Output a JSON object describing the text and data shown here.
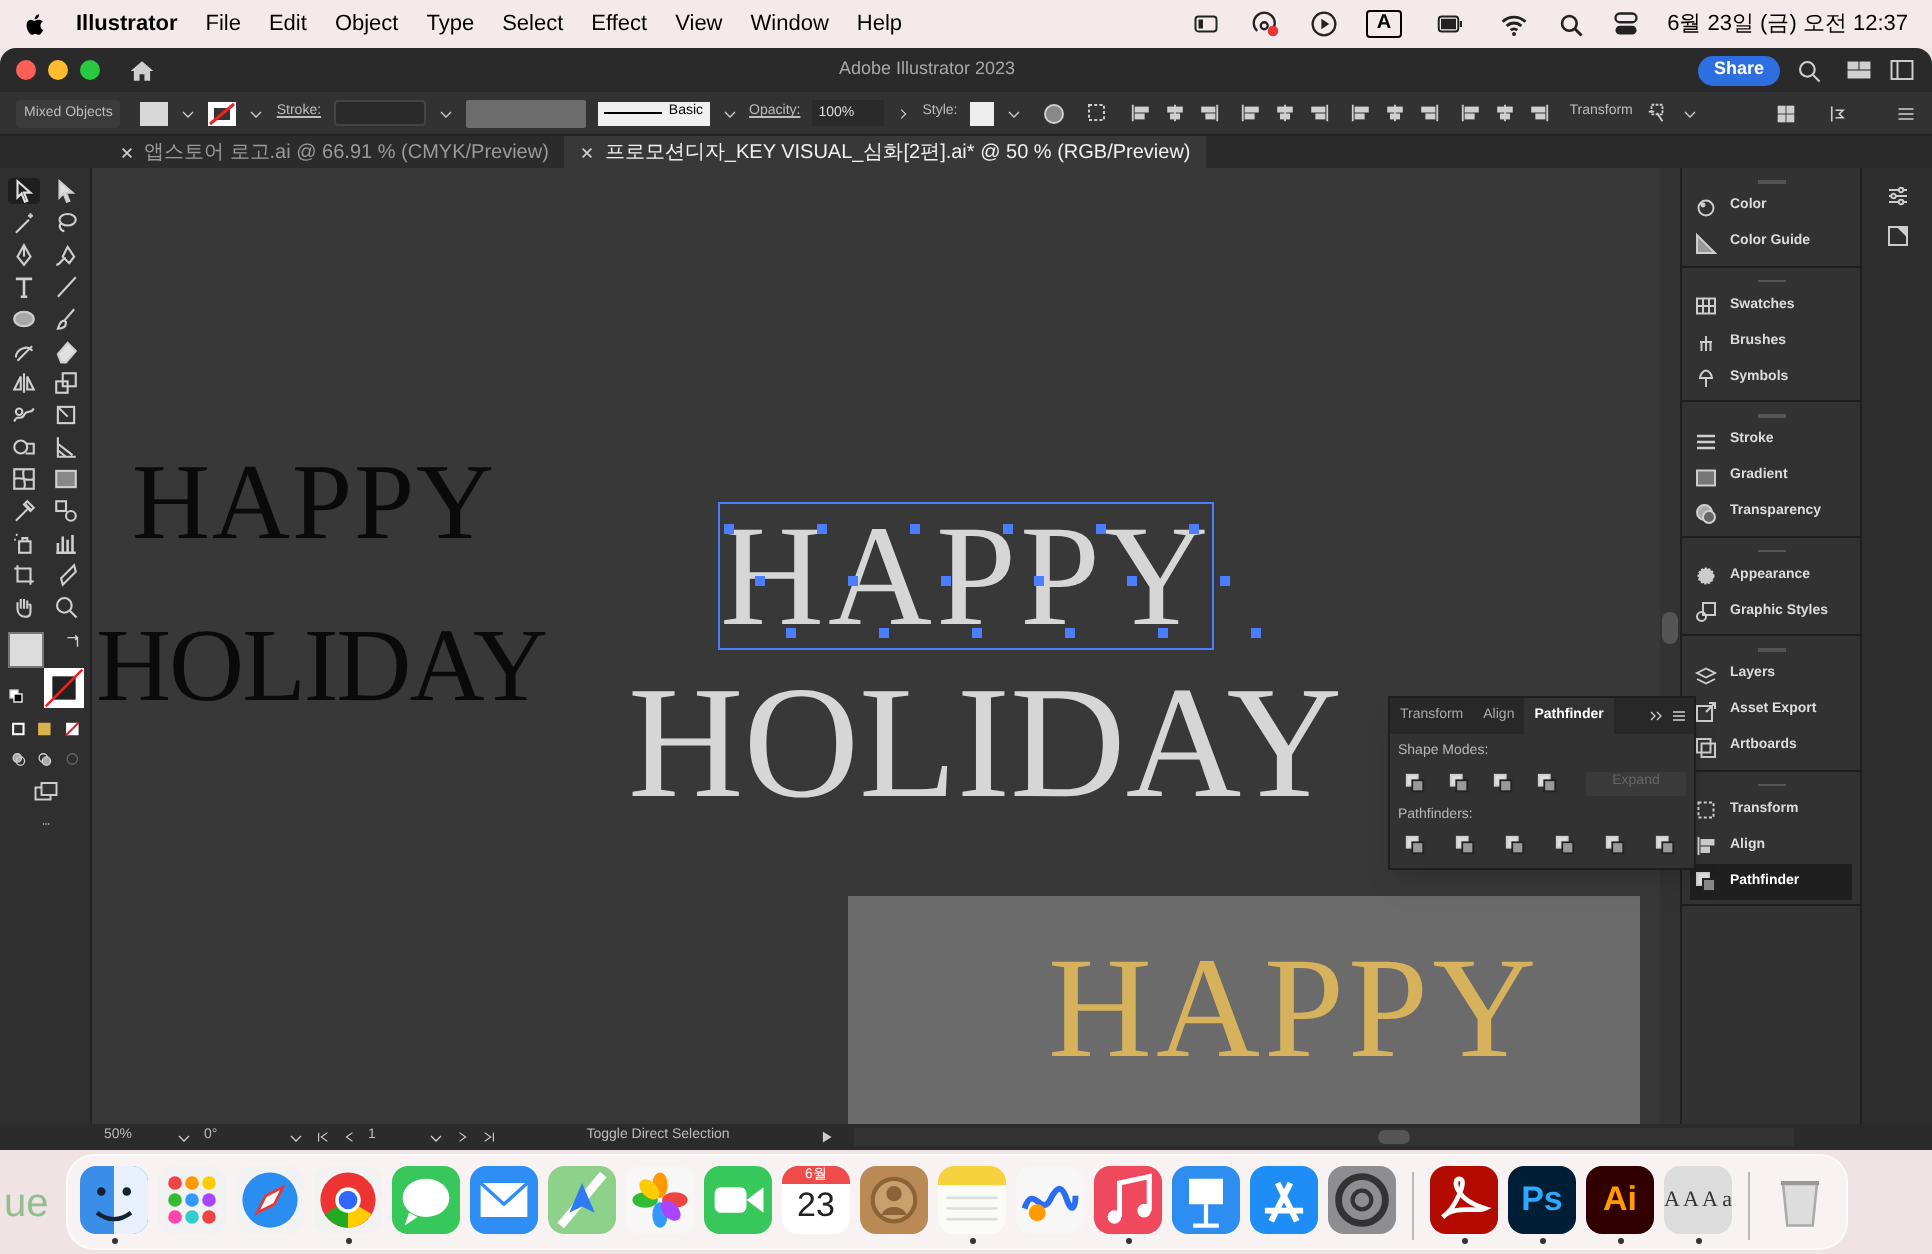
{
  "menu_bar": {
    "app": "Illustrator",
    "menus": [
      "File",
      "Edit",
      "Object",
      "Type",
      "Select",
      "Effect",
      "View",
      "Window",
      "Help"
    ],
    "input_source": "A",
    "clock": "6월 23일 (금) 오전 12:37"
  },
  "window": {
    "title": "Adobe Illustrator 2023",
    "share": "Share"
  },
  "control_bar": {
    "selection": "Mixed Objects",
    "stroke_label": "Stroke:",
    "brush": "Basic",
    "opacity_label": "Opacity:",
    "opacity": "100%",
    "style_label": "Style:",
    "transform": "Transform"
  },
  "doc_tabs": [
    {
      "label": "앱스토어 로고.ai @ 66.91 % (CMYK/Preview)",
      "selected": false
    },
    {
      "label": "프로모션디자_KEY VISUAL_심화[2편].ai* @ 50 % (RGB/Preview)",
      "selected": true
    }
  ],
  "artwork": [
    {
      "kind": "black",
      "text": "HAPPY",
      "selected": false
    },
    {
      "kind": "black",
      "text": "HOLIDAY",
      "selected": false
    },
    {
      "kind": "white",
      "text": "HAPPY",
      "selected": true
    },
    {
      "kind": "white",
      "text": "HOLIDAY",
      "selected": false
    },
    {
      "kind": "gold",
      "text": "HAPPY",
      "selected": false
    }
  ],
  "panels": [
    [
      {
        "label": "Color",
        "selected": false
      },
      {
        "label": "Color Guide",
        "selected": false
      }
    ],
    [
      {
        "label": "Swatches",
        "selected": false
      },
      {
        "label": "Brushes",
        "selected": false
      },
      {
        "label": "Symbols",
        "selected": false
      }
    ],
    [
      {
        "label": "Stroke",
        "selected": false
      },
      {
        "label": "Gradient",
        "selected": false
      },
      {
        "label": "Transparency",
        "selected": false
      }
    ],
    [
      {
        "label": "Appearance",
        "selected": false
      },
      {
        "label": "Graphic Styles",
        "selected": false
      }
    ],
    [
      {
        "label": "Layers",
        "selected": false
      },
      {
        "label": "Asset Export",
        "selected": false
      },
      {
        "label": "Artboards",
        "selected": false
      }
    ],
    [
      {
        "label": "Transform",
        "selected": false
      },
      {
        "label": "Align",
        "selected": false
      },
      {
        "label": "Pathfinder",
        "selected": true
      }
    ]
  ],
  "pathfinder": {
    "tabs": [
      {
        "label": "Transform",
        "selected": false
      },
      {
        "label": "Align",
        "selected": false
      },
      {
        "label": "Pathfinder",
        "selected": true
      }
    ],
    "shape_modes_label": "Shape Modes:",
    "expand": {
      "label": "Expand",
      "disabled": true
    },
    "pathfinders_label": "Pathfinders:"
  },
  "status_bar": {
    "zoom": "50%",
    "rotation": "0°",
    "artboard": "1",
    "tool_hint": "Toggle Direct Selection"
  },
  "desktop_fragment": "ue",
  "dock": [
    {
      "kind": "finder",
      "running": true
    },
    {
      "kind": "launchpad",
      "running": false
    },
    {
      "kind": "safari",
      "running": false
    },
    {
      "kind": "chrome",
      "running": true
    },
    {
      "kind": "messages",
      "running": false
    },
    {
      "kind": "mail",
      "running": false
    },
    {
      "kind": "maps",
      "running": false
    },
    {
      "kind": "photos",
      "running": false
    },
    {
      "kind": "facetime",
      "running": false
    },
    {
      "kind": "calendar",
      "month": "6월",
      "day": "23",
      "running": false
    },
    {
      "kind": "contacts",
      "running": false
    },
    {
      "kind": "notes",
      "running": true
    },
    {
      "kind": "freeform",
      "running": false
    },
    {
      "kind": "music",
      "running": true
    },
    {
      "kind": "keynote",
      "running": false
    },
    {
      "kind": "appstore",
      "running": false
    },
    {
      "kind": "settings",
      "running": false
    },
    {
      "kind": "separator"
    },
    {
      "kind": "acrobat",
      "running": true
    },
    {
      "kind": "photoshop",
      "text": "Ps",
      "running": true
    },
    {
      "kind": "illustrator",
      "text": "Ai",
      "running": true
    },
    {
      "kind": "fontbook",
      "text": "A A A a",
      "running": true
    },
    {
      "kind": "separator"
    },
    {
      "kind": "trash",
      "running": false
    }
  ]
}
